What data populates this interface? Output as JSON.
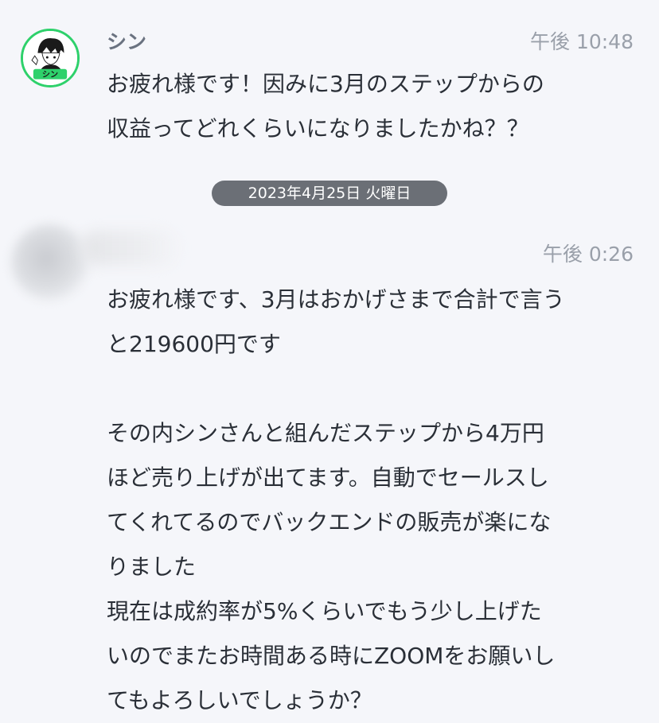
{
  "message1": {
    "sender": "シン",
    "time": "午後 10:48",
    "text": "お疲れ様です！因みに3月のステップからの\n収益ってどれくらいになりましたかね？？"
  },
  "date_separator": "2023年4月25日 火曜日",
  "message2": {
    "time": "午後 0:26",
    "text": "お疲れ様です、3月はおかげさまで合計で言う\nと219600円です\n\nその内シンさんと組んだステップから4万円\nほど売り上げが出てます。自動でセールスし\nてくれてるのでバックエンドの販売が楽にな\nりました\n現在は成約率が5%くらいでもう少し上げた\nいのでまたお時間ある時にZOOMをお願いし\nてもよろしいでしょうか？"
  },
  "avatar_logo_text": "シン",
  "colors": {
    "background": "#f5f6fa",
    "avatar_ring": "#2ed16b",
    "date_pill": "#6b6f76"
  }
}
